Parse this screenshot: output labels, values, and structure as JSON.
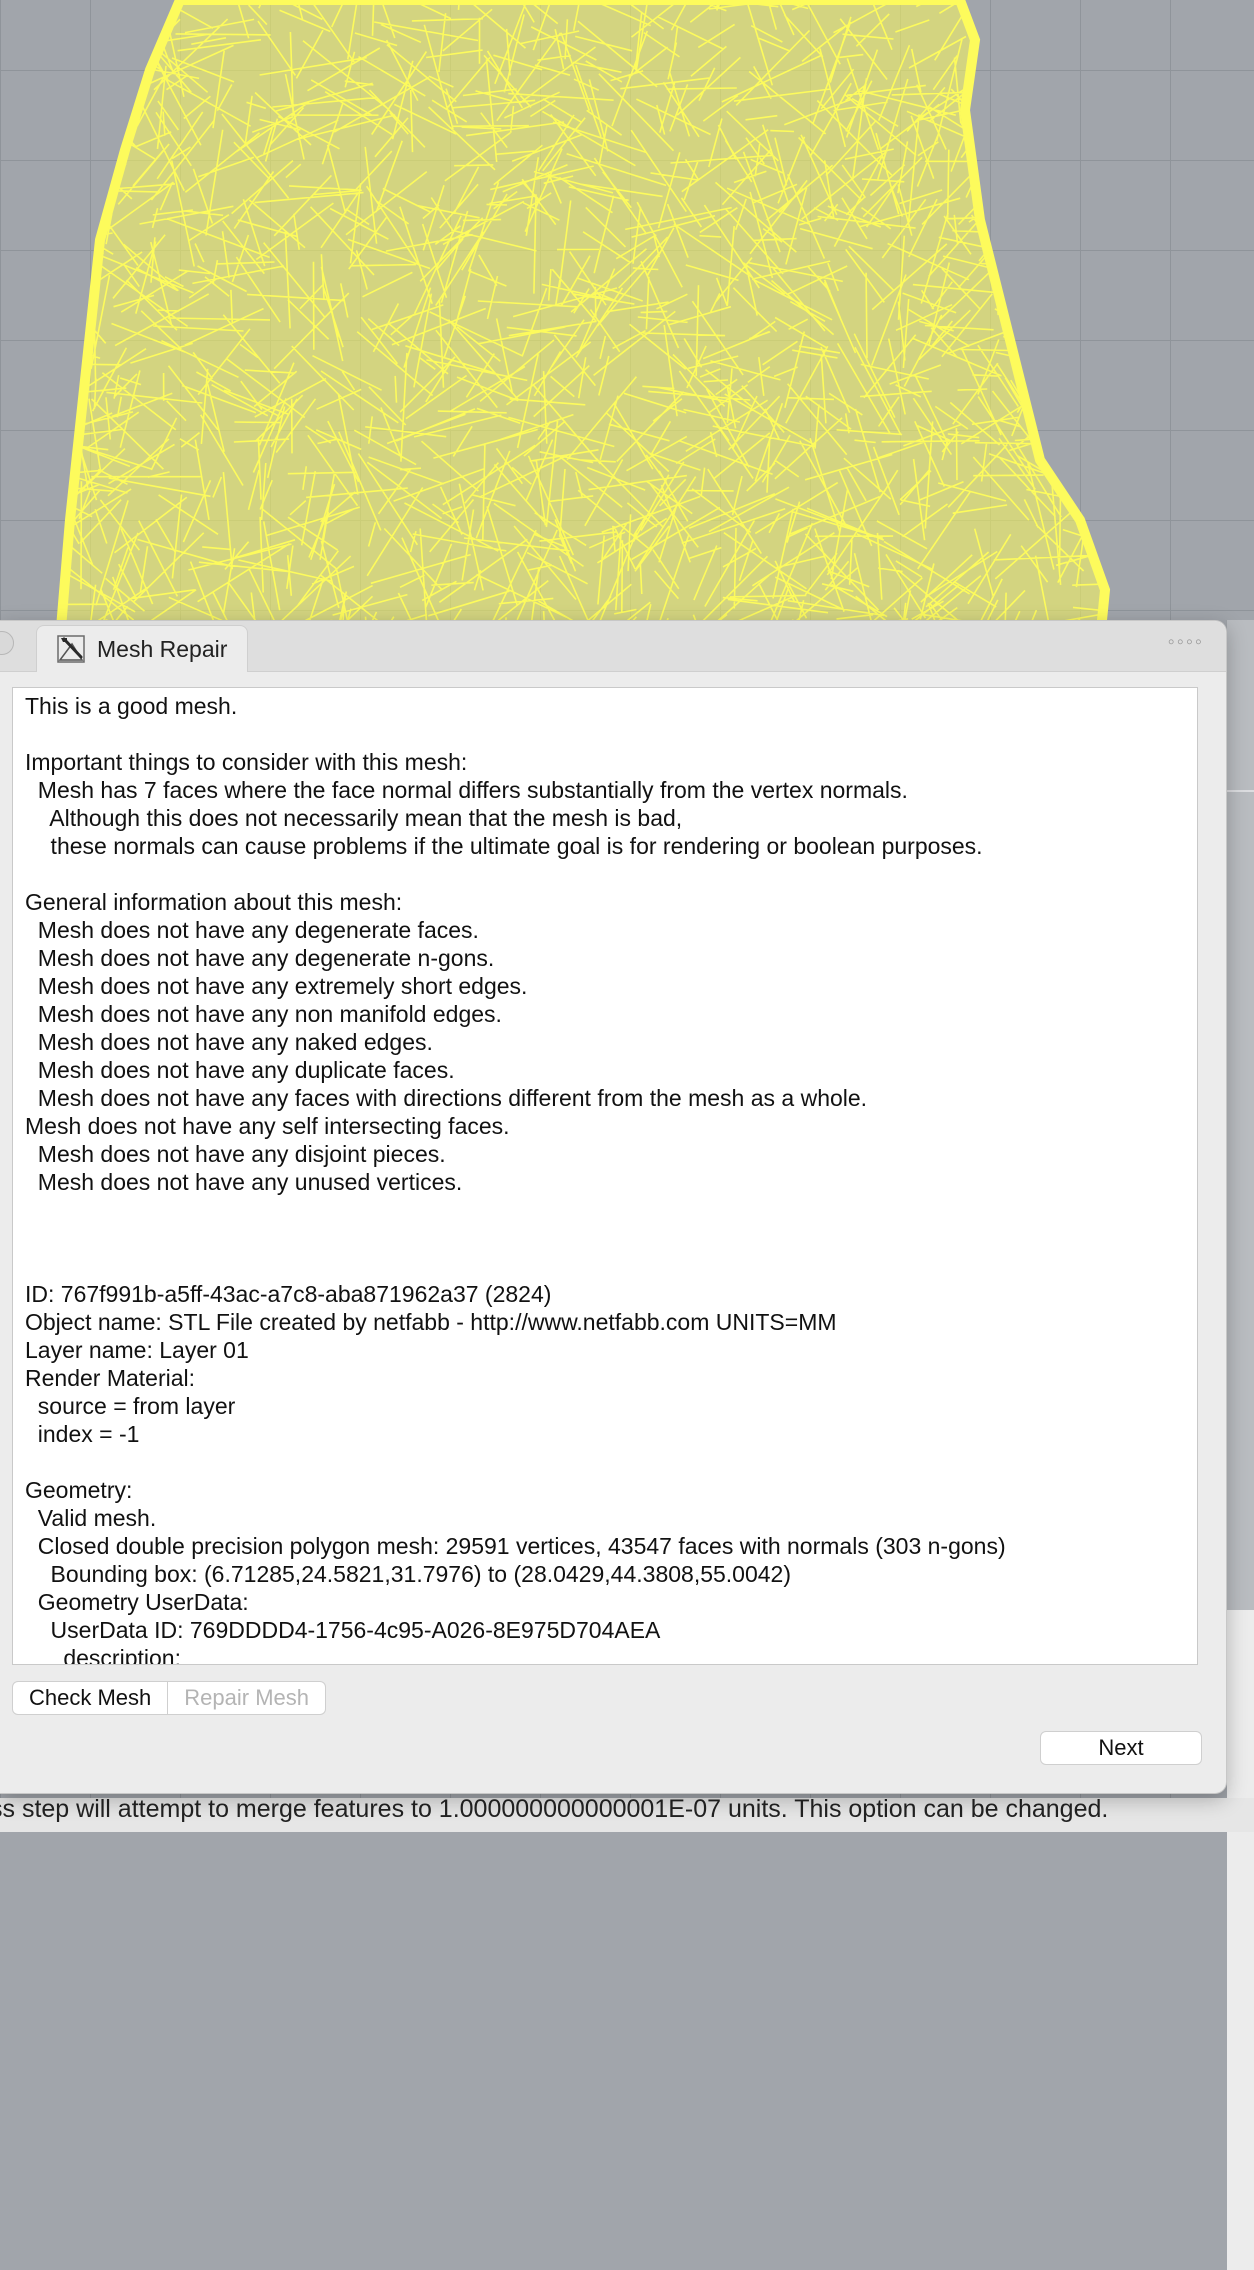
{
  "panel": {
    "tab_label": "Mesh Repair",
    "more_label": "◦◦◦◦",
    "report_lines": [
      "This is a good mesh.",
      "",
      "Important things to consider with this mesh:",
      "  Mesh has 7 faces where the face normal differs substantially from the vertex normals.",
      "    Although this does not necessarily mean that the mesh is bad,",
      "    these normals can cause problems if the ultimate goal is for rendering or boolean purposes.",
      "",
      "General information about this mesh:",
      "  Mesh does not have any degenerate faces.",
      "  Mesh does not have any degenerate n-gons.",
      "  Mesh does not have any extremely short edges.",
      "  Mesh does not have any non manifold edges.",
      "  Mesh does not have any naked edges.",
      "  Mesh does not have any duplicate faces.",
      "  Mesh does not have any faces with directions different from the mesh as a whole.",
      "Mesh does not have any self intersecting faces.",
      "  Mesh does not have any disjoint pieces.",
      "  Mesh does not have any unused vertices.",
      "",
      "",
      "",
      "ID: 767f991b-a5ff-43ac-a7c8-aba871962a37 (2824)",
      "Object name: STL File created by netfabb - http://www.netfabb.com UNITS=MM",
      "Layer name: Layer 01",
      "Render Material:",
      "  source = from layer",
      "  index = -1",
      "",
      "Geometry:",
      "  Valid mesh.",
      "  Closed double precision polygon mesh: 29591 vertices, 43547 faces with normals (303 n-gons)",
      "    Bounding box: (6.71285,24.5821,31.7976) to (28.0429,44.3808,55.0042)",
      "  Geometry UserData:",
      "    UserData ID: 769DDDD4-1756-4c95-A026-8E975D704AEA",
      "      description:"
    ],
    "check_mesh_label": "Check Mesh",
    "repair_mesh_label": "Repair Mesh",
    "next_label": "Next"
  },
  "status_text": "ss step will attempt to merge features to 1.000000000000001E-07 units. This option can be changed.",
  "colors": {
    "mesh": "#fdfb5c",
    "viewport_bg": "#a1a5ab",
    "panel_bg": "#ececec"
  }
}
